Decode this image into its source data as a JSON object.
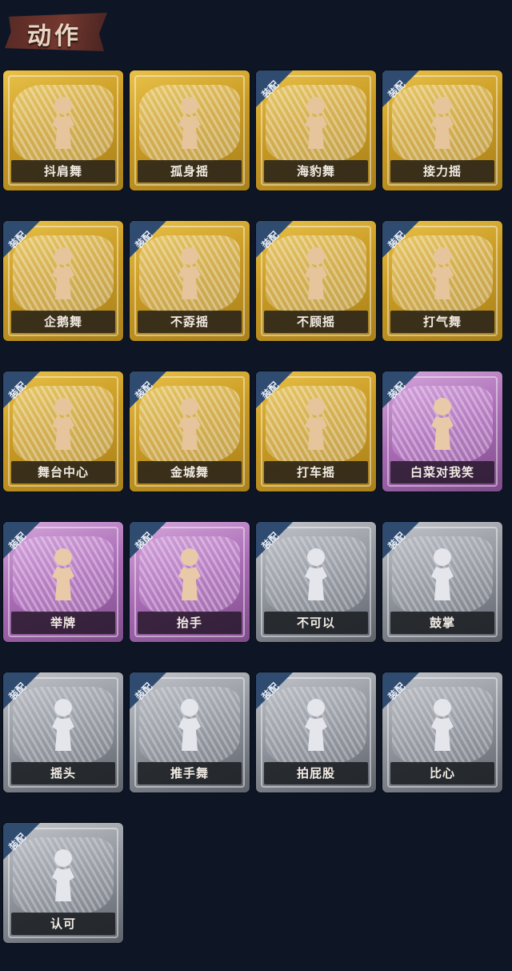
{
  "header": {
    "title": "动作"
  },
  "equip_label": "装配",
  "cards": [
    {
      "name": "抖肩舞",
      "rarity": "gold",
      "equipped": false
    },
    {
      "name": "孤身摇",
      "rarity": "gold",
      "equipped": false
    },
    {
      "name": "海豹舞",
      "rarity": "gold",
      "equipped": true
    },
    {
      "name": "接力摇",
      "rarity": "gold",
      "equipped": true
    },
    {
      "name": "企鹅舞",
      "rarity": "gold",
      "equipped": true
    },
    {
      "name": "不孬摇",
      "rarity": "gold",
      "equipped": true
    },
    {
      "name": "不顾摇",
      "rarity": "gold",
      "equipped": true
    },
    {
      "name": "打气舞",
      "rarity": "gold",
      "equipped": true
    },
    {
      "name": "舞台中心",
      "rarity": "gold",
      "equipped": true
    },
    {
      "name": "金城舞",
      "rarity": "gold",
      "equipped": true
    },
    {
      "name": "打车摇",
      "rarity": "gold",
      "equipped": true
    },
    {
      "name": "白菜对我笑",
      "rarity": "purple",
      "equipped": true
    },
    {
      "name": "举牌",
      "rarity": "purple",
      "equipped": true
    },
    {
      "name": "抬手",
      "rarity": "purple",
      "equipped": true
    },
    {
      "name": "不可以",
      "rarity": "silver",
      "equipped": true
    },
    {
      "name": "鼓掌",
      "rarity": "silver",
      "equipped": true
    },
    {
      "name": "摇头",
      "rarity": "silver",
      "equipped": true
    },
    {
      "name": "推手舞",
      "rarity": "silver",
      "equipped": true
    },
    {
      "name": "拍屁股",
      "rarity": "silver",
      "equipped": true
    },
    {
      "name": "比心",
      "rarity": "silver",
      "equipped": true
    },
    {
      "name": "认可",
      "rarity": "silver",
      "equipped": true
    }
  ],
  "colors": {
    "background": "#0e1626",
    "gold": "#d4a82e",
    "purple": "#a86bb4",
    "silver": "#8e939b",
    "badge": "#304b70"
  }
}
